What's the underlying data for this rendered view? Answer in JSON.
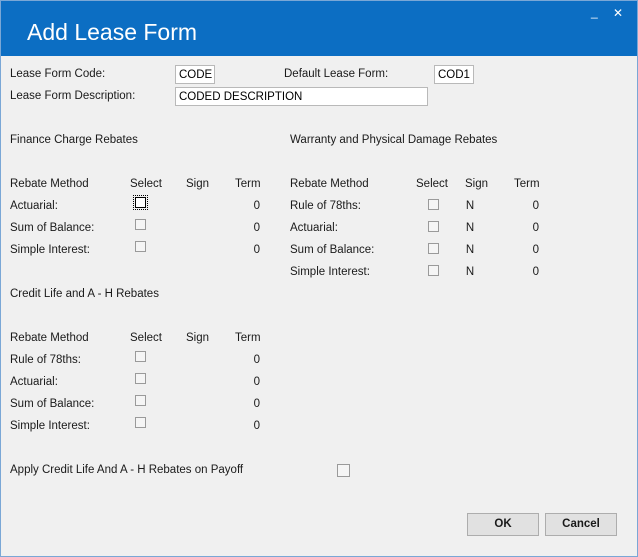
{
  "window": {
    "title": "Add Lease Form",
    "minimize_glyph": "_",
    "close_glyph": "✕"
  },
  "header": {
    "code_label": "Lease Form Code:",
    "code_value": "CODE",
    "default_label": "Default Lease Form:",
    "default_value": "COD1",
    "description_label": "Lease Form Description:",
    "description_value": "CODED DESCRIPTION"
  },
  "columns": {
    "method": "Rebate Method",
    "select": "Select",
    "sign": "Sign",
    "term": "Term"
  },
  "finance": {
    "title": "Finance Charge Rebates",
    "rows": [
      {
        "label": "Actuarial:",
        "sign": "",
        "term": "0"
      },
      {
        "label": "Sum of Balance:",
        "sign": "",
        "term": "0"
      },
      {
        "label": "Simple Interest:",
        "sign": "",
        "term": "0"
      }
    ]
  },
  "warranty": {
    "title": "Warranty and Physical Damage Rebates",
    "rows": [
      {
        "label": "Rule of 78ths:",
        "sign": "N",
        "term": "0"
      },
      {
        "label": "Actuarial:",
        "sign": "N",
        "term": "0"
      },
      {
        "label": "Sum of Balance:",
        "sign": "N",
        "term": "0"
      },
      {
        "label": "Simple Interest:",
        "sign": "N",
        "term": "0"
      }
    ]
  },
  "credit": {
    "title": "Credit Life and A - H Rebates",
    "rows": [
      {
        "label": "Rule of 78ths:",
        "sign": "",
        "term": "0"
      },
      {
        "label": "Actuarial:",
        "sign": "",
        "term": "0"
      },
      {
        "label": "Sum of Balance:",
        "sign": "",
        "term": "0"
      },
      {
        "label": "Simple Interest:",
        "sign": "",
        "term": "0"
      }
    ]
  },
  "payoff": {
    "label": "Apply Credit Life And A - H Rebates on Payoff"
  },
  "buttons": {
    "ok": "OK",
    "cancel": "Cancel"
  }
}
